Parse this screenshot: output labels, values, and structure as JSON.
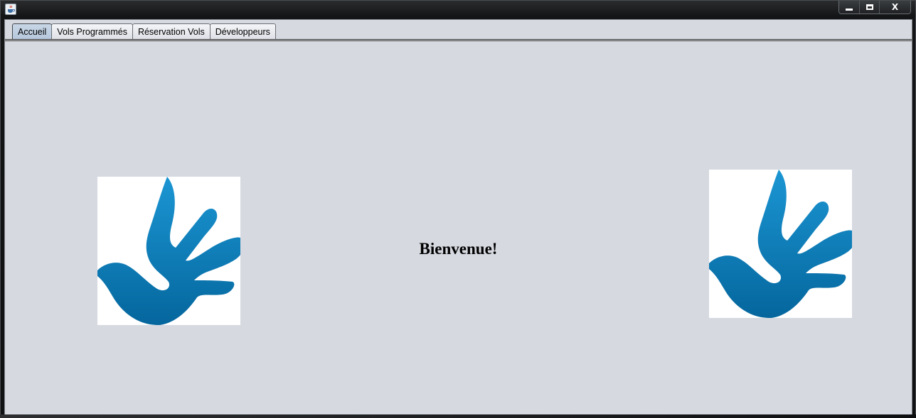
{
  "window": {
    "app_icon": "java-cup-icon",
    "controls": {
      "minimize": "minimize-icon",
      "maximize": "maximize-icon",
      "close_label": "X"
    }
  },
  "tabs": [
    {
      "label": "Accueil",
      "selected": true
    },
    {
      "label": "Vols Programmés",
      "selected": false
    },
    {
      "label": "Réservation Vols",
      "selected": false
    },
    {
      "label": "Développeurs",
      "selected": false
    }
  ],
  "main": {
    "welcome_text": "Bienvenue!",
    "logo_icon": "hand-dove-logo-icon"
  },
  "colors": {
    "panel_bg": "#d6d9e0",
    "logo_blue": "#0a74b1",
    "logo_blue_light": "#1b96d3",
    "selected_tab": "#b5c7dc"
  }
}
